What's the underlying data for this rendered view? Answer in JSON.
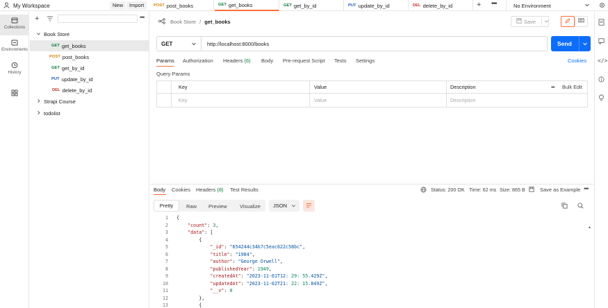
{
  "workspace": {
    "title": "My Workspace",
    "new_label": "New",
    "import_label": "Import"
  },
  "tabs": [
    {
      "method": "POST",
      "name": "post_books"
    },
    {
      "method": "GET",
      "name": "get_books"
    },
    {
      "method": "GET",
      "name": "get_by_id"
    },
    {
      "method": "PUT",
      "name": "update_by_id"
    },
    {
      "method": "DEL",
      "name": "delete_by_id"
    }
  ],
  "environment": {
    "selected": "No Environment"
  },
  "rail": {
    "collections": "Collections",
    "environments": "Environments",
    "history": "History"
  },
  "sidebar": {
    "collections": [
      {
        "name": "Book Store",
        "expanded": true
      },
      {
        "name": "Strapi Course",
        "expanded": false
      },
      {
        "name": "todolist",
        "expanded": false
      }
    ],
    "requests": [
      {
        "method": "GET",
        "name": "get_books"
      },
      {
        "method": "POST",
        "name": "post_books"
      },
      {
        "method": "GET",
        "name": "get_by_id"
      },
      {
        "method": "PUT",
        "name": "update_by_id"
      },
      {
        "method": "DEL",
        "name": "delete_by_id"
      }
    ]
  },
  "breadcrumb": {
    "collection": "Book Store",
    "separator": "/",
    "request": "get_books"
  },
  "save_label": "Save",
  "request": {
    "method": "GET",
    "url": "http://localhost:8000/books",
    "send_label": "Send"
  },
  "request_tabs": {
    "items": [
      "Params",
      "Authorization",
      "Headers",
      "Body",
      "Pre-request Script",
      "Tests",
      "Settings"
    ],
    "headers_count": "(6)",
    "cookies": "Cookies"
  },
  "query_params": {
    "title": "Query Params",
    "columns": [
      "Key",
      "Value",
      "Description"
    ],
    "bulk_edit": "Bulk Edit",
    "placeholders": {
      "key": "Key",
      "value": "Value",
      "description": "Description"
    }
  },
  "response": {
    "tabs": [
      "Body",
      "Cookies",
      "Headers",
      "Test Results"
    ],
    "headers_count": "(8)",
    "status": "Status: 200 OK",
    "time": "Time: 62 ms",
    "size": "Size: 865 B",
    "save_example": "Save as Example",
    "view_modes": [
      "Pretty",
      "Raw",
      "Preview",
      "Visualize"
    ],
    "format": "JSON"
  },
  "code_lines": [
    "{",
    "    \"count\": 3,",
    "    \"data\": [",
    "        {",
    "            \"_id\": \"654244c34b7c5eac622c58bc\",",
    "            \"title\": \"1984\",",
    "            \"author\": \"George Orwell\",",
    "            \"publishedYear\": 1949,",
    "            \"createdAt\": \"2023-11-01T12:29:55.429Z\",",
    "            \"updatedAt\": \"2023-11-02T21:22:15.849Z\",",
    "            \"__v\": 0",
    "        },",
    "        {"
  ],
  "colors": {
    "accent": "#ff6c37",
    "send": "#0d6efd",
    "get": "#0a7a3a",
    "post": "#d8840e",
    "put": "#1e5bb8",
    "delete": "#c0342b"
  }
}
